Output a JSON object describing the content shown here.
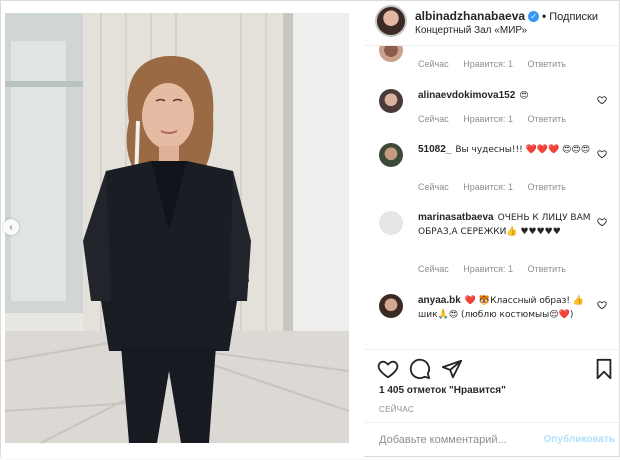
{
  "header": {
    "username": "albinadzhanabaeva",
    "verified_mark": "✓",
    "separator": "•",
    "follow_label": "Подписки",
    "location": "Концертный Зал «МИР»"
  },
  "comments": [
    {
      "user": "",
      "text": "",
      "time": "Сейчас",
      "likes": "Нравится: 1",
      "reply": "Ответить"
    },
    {
      "user": "alinaevdokimova152",
      "text": "😍",
      "time": "Сейчас",
      "likes": "Нравится: 1",
      "reply": "Ответить"
    },
    {
      "user": "51082_",
      "text": "Вы чудесны!!! ❤️❤️❤️ 😍😍😍",
      "time": "Сейчас",
      "likes": "Нравится: 1",
      "reply": "Ответить"
    },
    {
      "user": "marinasatbaeva",
      "text": "ОЧЕНЬ К ЛИЦУ ВАМ ОБРАЗ,А СЕРЕЖКИ👍 ♥♥♥♥♥",
      "time": "Сейчас",
      "likes": "Нравится: 1",
      "reply": "Ответить"
    },
    {
      "user": "anyaa.bk",
      "text": "❤️ 🐯Классный образ! 👍шик🙏😍 (люблю костюмыы😌❤️)",
      "time": "",
      "likes": "",
      "reply": ""
    }
  ],
  "actions": {
    "likes_text": "1 405 отметок \"Нравится\"",
    "time_text": "СЕЙЧАС",
    "comment_placeholder": "Добавьте комментарий...",
    "publish_label": "Опубликовать"
  },
  "photo": {
    "nav_prev_glyph": "‹"
  },
  "colors": {
    "accent": "#3897f0",
    "publish_disabled": "#b2dffc",
    "muted": "#8e8e8e",
    "text": "#262626"
  }
}
